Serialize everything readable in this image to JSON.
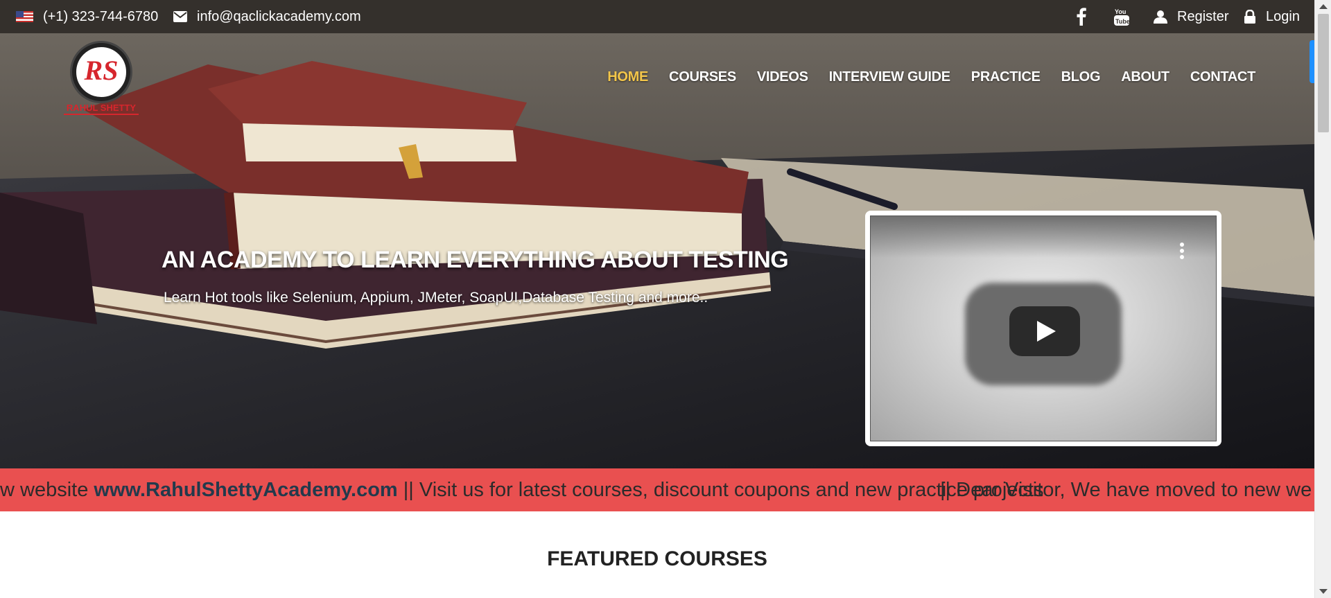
{
  "topbar": {
    "phone": "(+1) 323-744-6780",
    "email": "info@qaclickacademy.com",
    "register_label": "Register",
    "login_label": "Login",
    "icons": [
      "us-flag-icon",
      "envelope-icon",
      "facebook-icon",
      "youtube-icon",
      "user-icon",
      "lock-icon"
    ]
  },
  "logo": {
    "monogram": "RS",
    "name": "RAHUL SHETTY"
  },
  "nav": {
    "items": [
      "HOME",
      "COURSES",
      "VIDEOS",
      "INTERVIEW GUIDE",
      "PRACTICE",
      "BLOG",
      "ABOUT",
      "CONTACT"
    ],
    "active": "HOME",
    "active_color": "#f3c64a"
  },
  "hero": {
    "title": "AN ACADEMY TO LEARN EVERYTHING ABOUT TESTING",
    "subtitle": "Learn Hot tools like Selenium, Appium, JMeter, SoapUI,Database Testing and more.."
  },
  "marquee": {
    "text_before": "w website ",
    "site": "www.RahulShettyAcademy.com",
    "text_after": " || Visit us for latest courses, discount coupons and new practice projects",
    "overlap_text": "|| Dear Visitor, We have moved to new we",
    "background": "#e95050"
  },
  "featured": {
    "heading": "FEATURED COURSES"
  }
}
